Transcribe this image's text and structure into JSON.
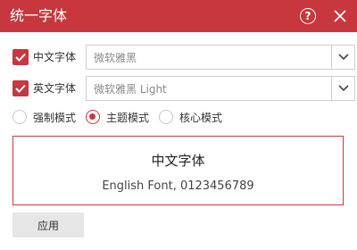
{
  "window": {
    "title": "统一字体",
    "help_icon": "?",
    "close_icon": "close-icon"
  },
  "theme": {
    "accent": "#c8373e"
  },
  "settings": {
    "chinese_font": {
      "label": "中文字体",
      "checked": true,
      "value": "微软雅黑"
    },
    "english_font": {
      "label": "英文字体",
      "checked": true,
      "value": "微软雅黑 Light"
    }
  },
  "modes": [
    {
      "label": "强制模式",
      "checked": false
    },
    {
      "label": "主题模式",
      "checked": true
    },
    {
      "label": "核心模式",
      "checked": false
    }
  ],
  "preview": {
    "chinese_text": "中文字体",
    "english_text": "English Font, 0123456789"
  },
  "actions": {
    "apply_label": "应用"
  }
}
